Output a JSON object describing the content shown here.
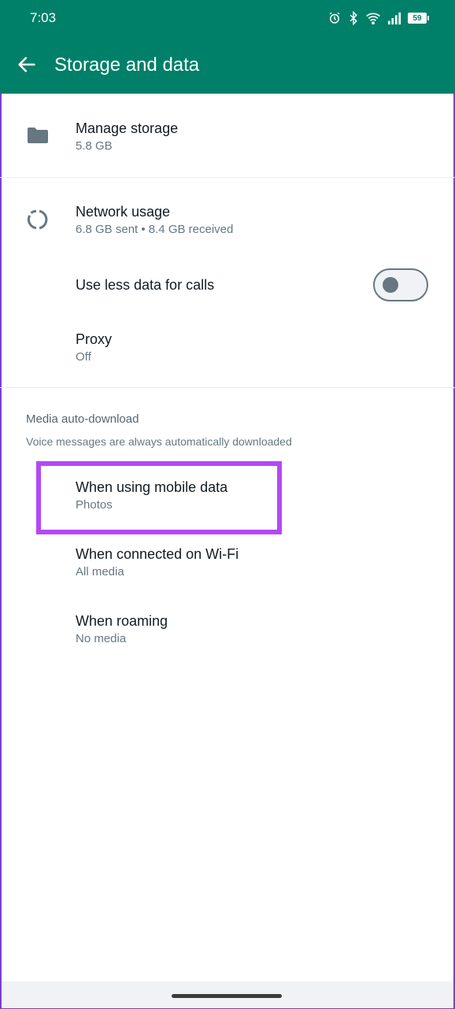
{
  "status_bar": {
    "time": "7:03",
    "battery": "59"
  },
  "header": {
    "title": "Storage and data"
  },
  "items": {
    "manage_storage": {
      "label": "Manage storage",
      "value": "5.8 GB"
    },
    "network_usage": {
      "label": "Network usage",
      "value": "6.8 GB sent • 8.4 GB received"
    },
    "less_data_calls": {
      "label": "Use less data for calls",
      "toggle_on": false
    },
    "proxy": {
      "label": "Proxy",
      "value": "Off"
    }
  },
  "media_section": {
    "title": "Media auto-download",
    "subtitle": "Voice messages are always automatically downloaded",
    "items": [
      {
        "label": "When using mobile data",
        "value": "Photos"
      },
      {
        "label": "When connected on Wi-Fi",
        "value": "All media"
      },
      {
        "label": "When roaming",
        "value": "No media"
      }
    ]
  },
  "colors": {
    "header_bg": "#008069",
    "highlight": "#b548f5",
    "icon_gray": "#667781"
  }
}
